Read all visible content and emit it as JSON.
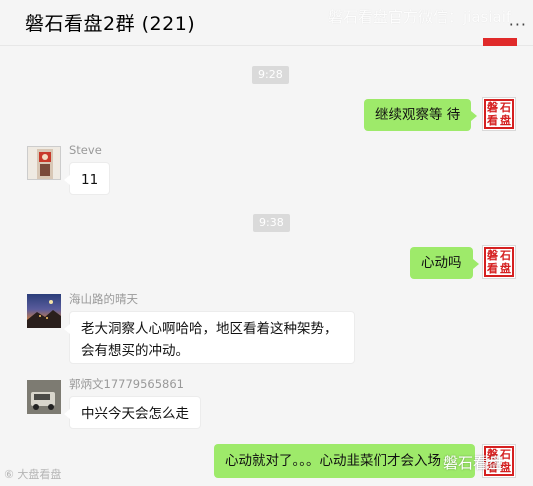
{
  "header": {
    "title": "磐石看盘2群 (221)",
    "watermark": "磐石看盘官方微信：jiasiaif",
    "more_icon": "more-dots-icon"
  },
  "messages": {
    "ts1": "9:28",
    "m1": "继续观察等 待",
    "steve_name": "Steve",
    "m2": "11",
    "ts2": "9:38",
    "m3": "心动吗",
    "hs_name": "海山路的晴天",
    "m4_line1": "老大洞察人心啊哈哈，地区看着这种架势，",
    "m4_line2": "会有想买的冲动。",
    "gbw_name": "郭炳文17779565861",
    "m5": "中兴今天会怎么走",
    "m6": "心动就对了。。。心动韭菜们才会入场"
  },
  "seal": [
    "磐",
    "石",
    "看",
    "盘"
  ],
  "watermarks": {
    "bottom_right": "磐石看盘",
    "bottom_left": "⑥ 大盘看盘"
  },
  "colors": {
    "bubble_self": "#9eea6a",
    "bubble_other": "#ffffff",
    "seal_red": "#d52020",
    "background": "#f5f5f5"
  }
}
